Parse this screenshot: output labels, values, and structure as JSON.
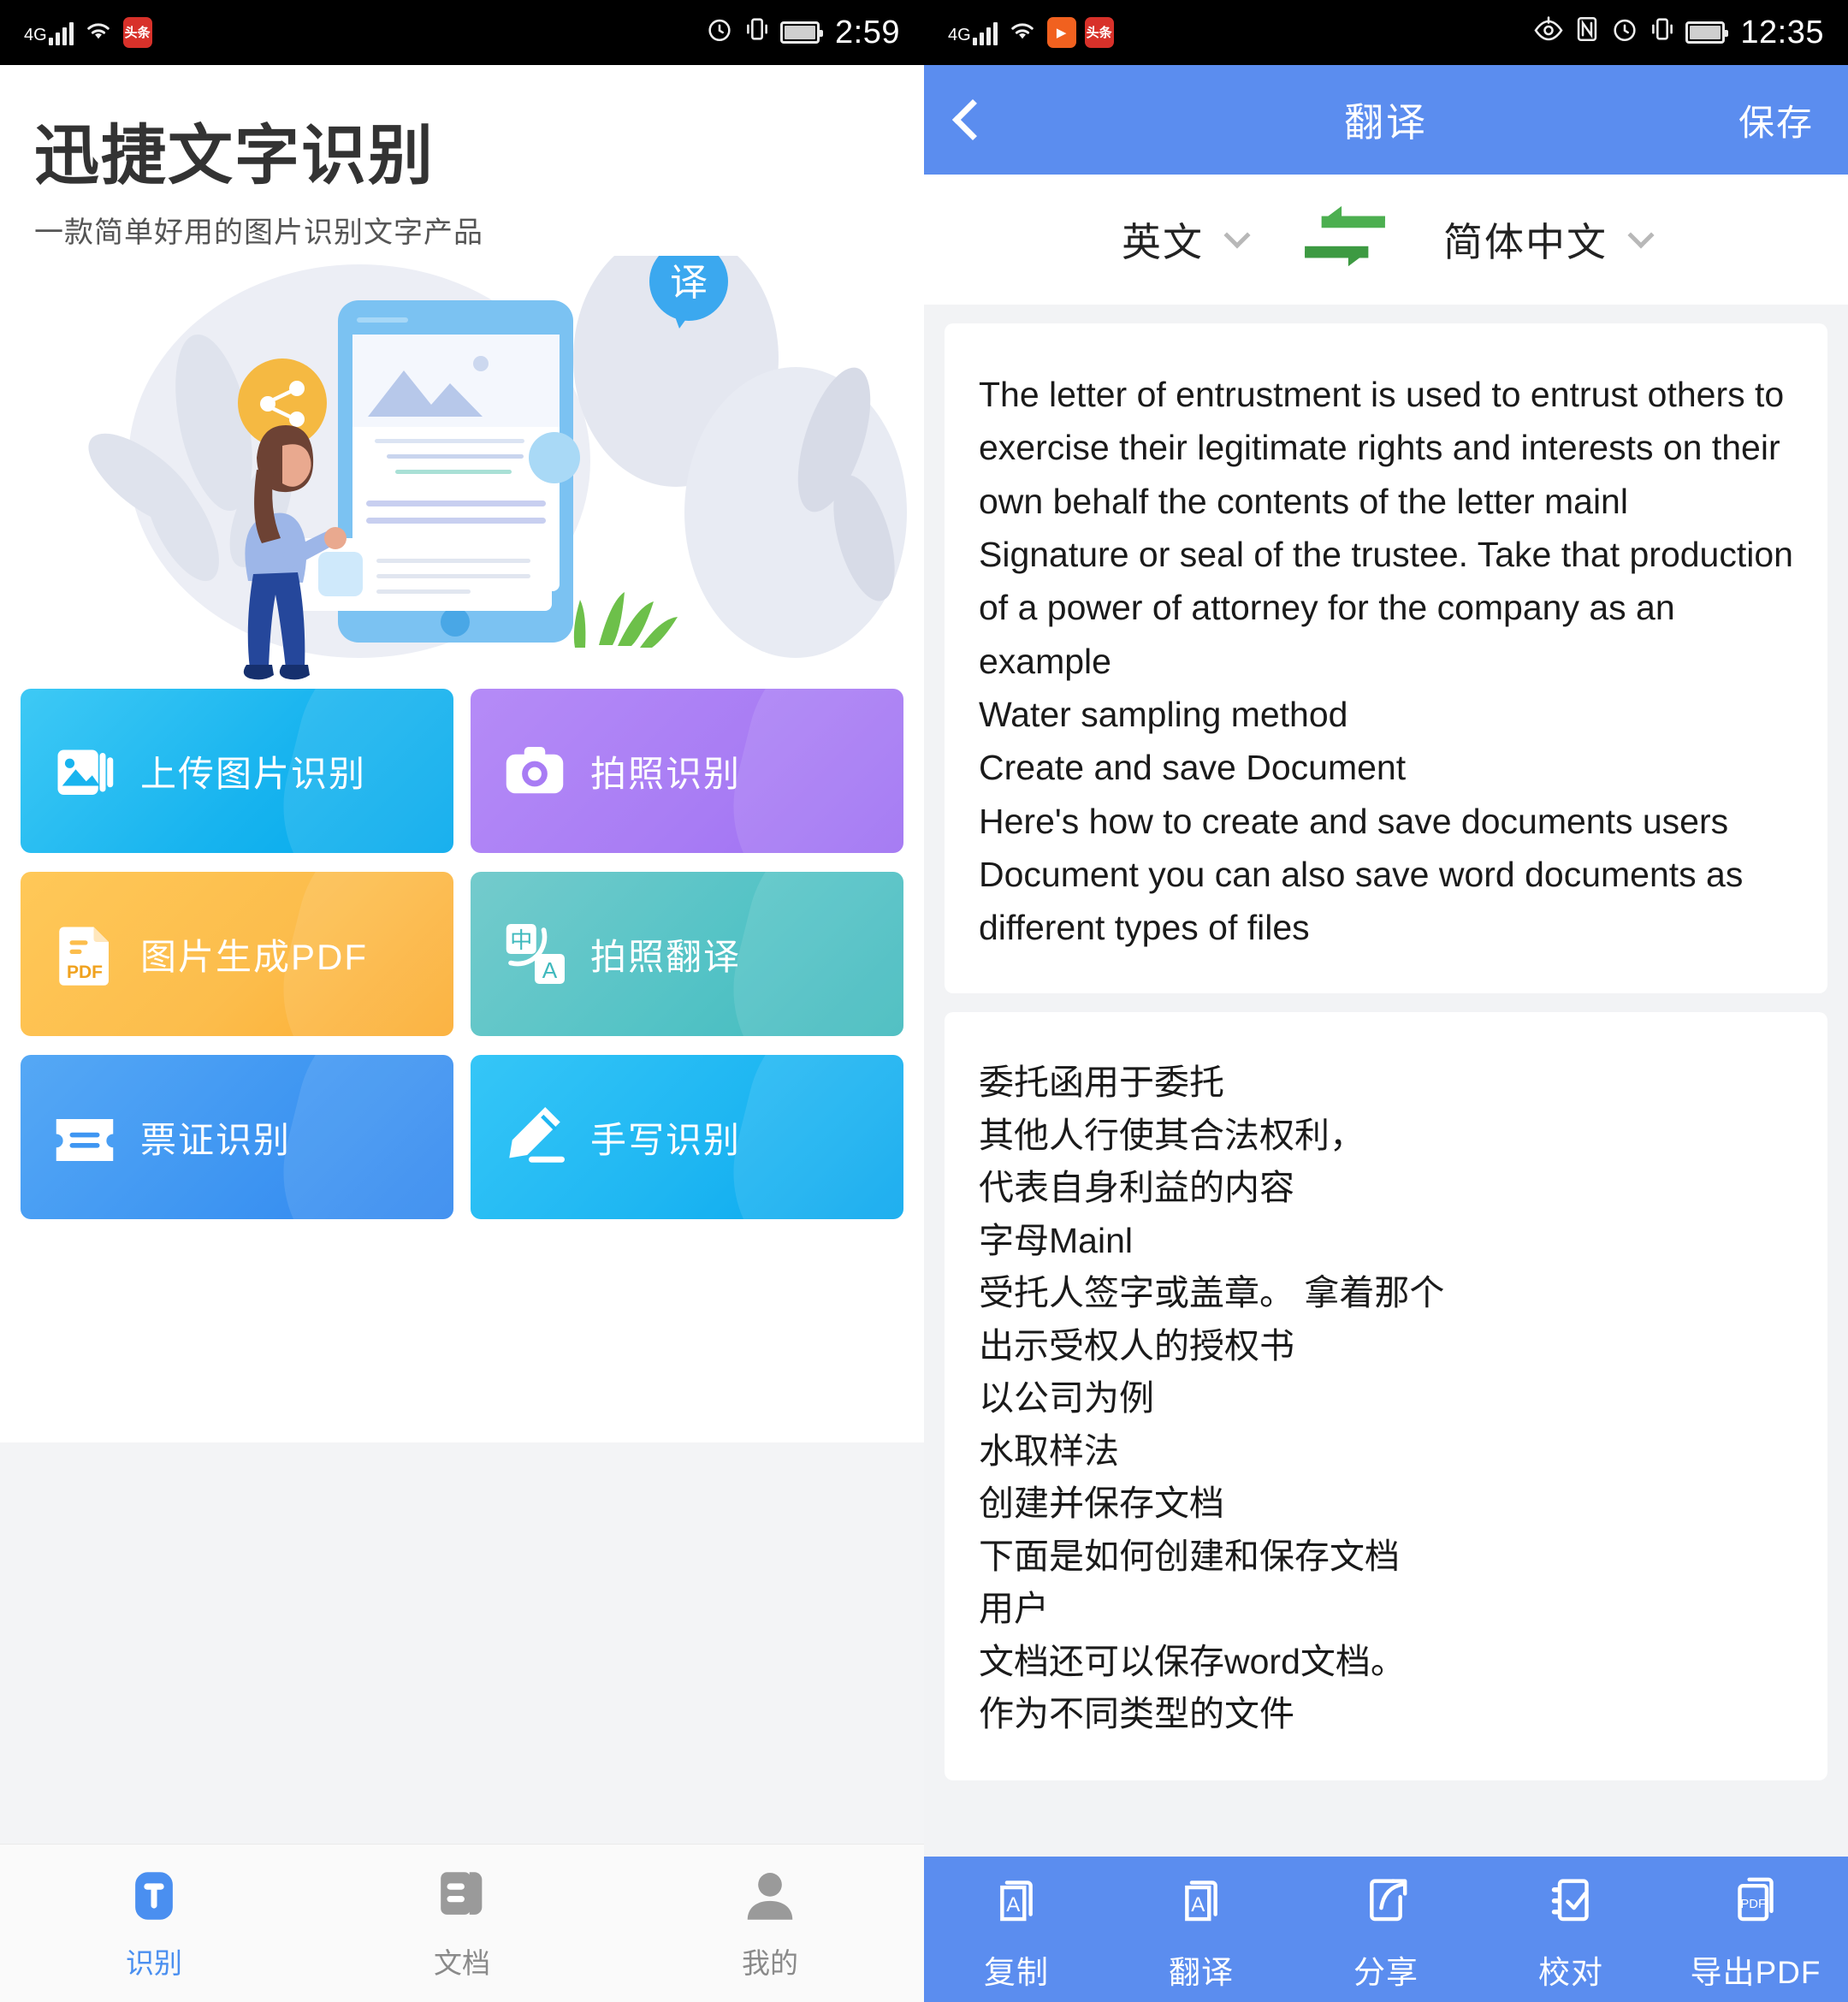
{
  "left": {
    "statusbar": {
      "network": "4G",
      "time": "2:59",
      "icons": [
        "signal-icon",
        "wifi-icon",
        "news-app-icon",
        "alarm-icon",
        "vibrate-icon",
        "battery-icon"
      ]
    },
    "hero": {
      "title": "迅捷文字识别",
      "subtitle": "一款简单好用的图片识别文字产品",
      "illustration_badges": {
        "share": "share-icon",
        "translate": "译"
      }
    },
    "cards": [
      {
        "label": "上传图片识别",
        "icon": "image-stack-icon",
        "color": "#18b4ef"
      },
      {
        "label": "拍照识别",
        "icon": "camera-icon",
        "color": "#a87cf4"
      },
      {
        "label": "图片生成PDF",
        "icon": "pdf-file-icon",
        "color": "#fcbd4c"
      },
      {
        "label": "拍照翻译",
        "icon": "translate-icon",
        "color": "#54c3c6"
      },
      {
        "label": "票证识别",
        "icon": "ticket-icon",
        "color": "#3f96f2"
      },
      {
        "label": "手写识别",
        "icon": "pencil-icon",
        "color": "#1eb6f2"
      }
    ],
    "tabs": [
      {
        "label": "识别",
        "icon": "text-t-icon",
        "active": true
      },
      {
        "label": "文档",
        "icon": "document-icon",
        "active": false
      },
      {
        "label": "我的",
        "icon": "person-icon",
        "active": false
      }
    ]
  },
  "right": {
    "statusbar": {
      "network": "4G",
      "time": "12:35",
      "icons": [
        "signal-icon",
        "wifi-icon",
        "play-app-icon",
        "news-app-icon",
        "eye-off-icon",
        "nfc-icon",
        "alarm-icon",
        "vibrate-icon",
        "battery-icon"
      ]
    },
    "appbar": {
      "back": "back-chevron-icon",
      "title": "翻译",
      "save_label": "保存",
      "accent": "#5b8def"
    },
    "language": {
      "source": "英文",
      "target": "简体中文",
      "swap_icon": "swap-arrows-icon",
      "swap_color": "#4caf50"
    },
    "source_text": "The letter of entrustment is used to entrust others to exercise their legitimate rights and interests on their own behalf the contents of the letter mainl\nSignature or seal of the trustee. Take that production of a power of attorney for the company as an example\nWater sampling method\nCreate and save Document\nHere's how to create and save documents users\nDocument you can also save word documents as different types of files",
    "translated_text": "委托函用于委托\n其他人行使其合法权利，\n代表自身利益的内容\n字母Mainl\n受托人签字或盖章。 拿着那个\n出示受权人的授权书\n以公司为例\n水取样法\n创建并保存文档\n下面是如何创建和保存文档\n用户\n文档还可以保存word文档。\n作为不同类型的文件",
    "toolbar": [
      {
        "label": "复制",
        "icon": "copy-a-icon"
      },
      {
        "label": "翻译",
        "icon": "translate-a-icon"
      },
      {
        "label": "分享",
        "icon": "share-arrow-icon"
      },
      {
        "label": "校对",
        "icon": "proofread-check-icon"
      },
      {
        "label": "导出PDF",
        "icon": "export-pdf-icon"
      }
    ]
  }
}
